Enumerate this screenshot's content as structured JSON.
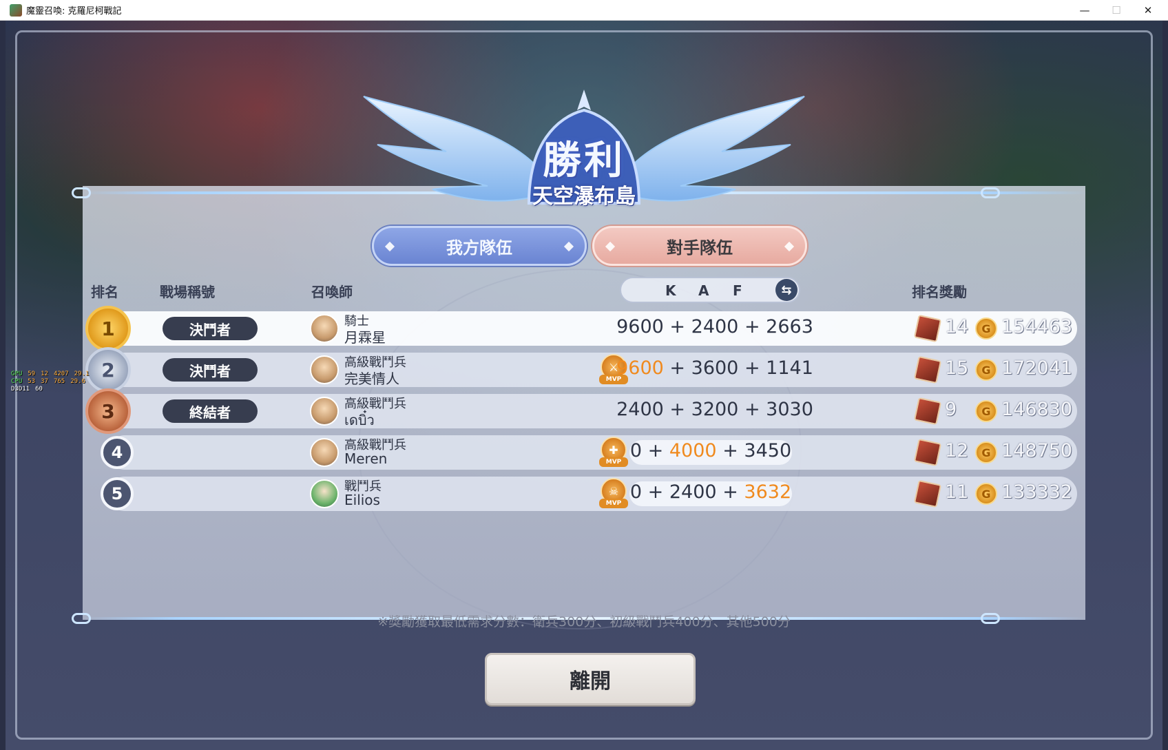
{
  "window": {
    "title": "魔靈召喚: 克羅尼柯戰記",
    "controls": {
      "minimize": "—",
      "maximize": "☐",
      "close": "✕"
    }
  },
  "result": {
    "title": "勝利",
    "map_name": "天空瀑布島"
  },
  "tabs": {
    "mine": "我方隊伍",
    "enemy": "對手隊伍",
    "active": "mine"
  },
  "headers": {
    "rank": "排名",
    "battle_title": "戰場稱號",
    "summoner": "召喚師",
    "k": "K",
    "a": "A",
    "f": "F",
    "rank_reward": "排名獎勵"
  },
  "rows": [
    {
      "rank": "1",
      "battle_title": "決鬥者",
      "class": "騎士",
      "name": "月霖星",
      "mvp": false,
      "k": "9600",
      "a": "2400",
      "f": "2663",
      "highlight": "",
      "reward_count": "14",
      "gold": "154463"
    },
    {
      "rank": "2",
      "battle_title": "決鬥者",
      "class": "高級戰鬥兵",
      "name": "完美情人",
      "mvp": true,
      "k": "9600",
      "a": "3600",
      "f": "1141",
      "highlight": "k",
      "reward_count": "15",
      "gold": "172041"
    },
    {
      "rank": "3",
      "battle_title": "終結者",
      "class": "高級戰鬥兵",
      "name": "เดบิ๋ว",
      "mvp": false,
      "k": "2400",
      "a": "3200",
      "f": "3030",
      "highlight": "",
      "reward_count": "9",
      "gold": "146830"
    },
    {
      "rank": "4",
      "battle_title": "",
      "class": "高級戰鬥兵",
      "name": "Meren",
      "mvp": true,
      "k": "0",
      "a": "4000",
      "f": "3450",
      "highlight": "a",
      "reward_count": "12",
      "gold": "148750"
    },
    {
      "rank": "5",
      "battle_title": "",
      "class": "戰鬥兵",
      "name": "Eilios",
      "mvp": true,
      "k": "0",
      "a": "2400",
      "f": "3632",
      "highlight": "f",
      "reward_count": "11",
      "gold": "133332"
    }
  ],
  "mvp_label": "MVP",
  "plus": "+",
  "footnote": "※獎勵獲取最低需求分數：衛兵300分、初級戰鬥兵400分、其他500分",
  "leave_button": "離開",
  "perf_overlay": {
    "gpu_label": "GPU",
    "cpu_label": "CPU",
    "d3d_label": "D3D11",
    "gpu_temp": "59",
    "cpu_temp": "53",
    "gpu_load": "12",
    "cpu_load": "37",
    "gpu_clock": "4207",
    "cpu_clock": "765",
    "gpu_val": "29.1",
    "cpu_val": "29.6",
    "fps": "60"
  },
  "colors": {
    "highlight_orange": "#f08a1e",
    "tab_mine": "#7690da",
    "tab_enemy": "#eab3aa",
    "title_badge": "#373d4f"
  }
}
